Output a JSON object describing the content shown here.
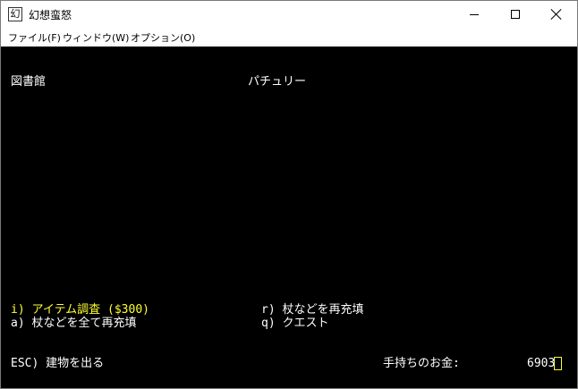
{
  "window": {
    "title": "幻想蛮怒",
    "icon_char": "幻",
    "icon": "app-icon"
  },
  "menu": {
    "file": "ファイル(F)",
    "window": "ウィンドウ(W)",
    "option": "オプション(O)"
  },
  "screen": {
    "location": "図書館",
    "npc": "パチュリー",
    "commands": {
      "identify": "i) アイテム調査 ($300)",
      "recharge": "r) 杖などを再充填",
      "recharge_all": "a) 杖などを全て再充填",
      "quest": "q) クエスト",
      "exit": "ESC) 建物を出る"
    },
    "gold_label": "手持ちのお金:",
    "gold_value": "6903"
  },
  "colors": {
    "background": "#000000",
    "text": "#ffffff",
    "highlight": "#ffff33"
  }
}
